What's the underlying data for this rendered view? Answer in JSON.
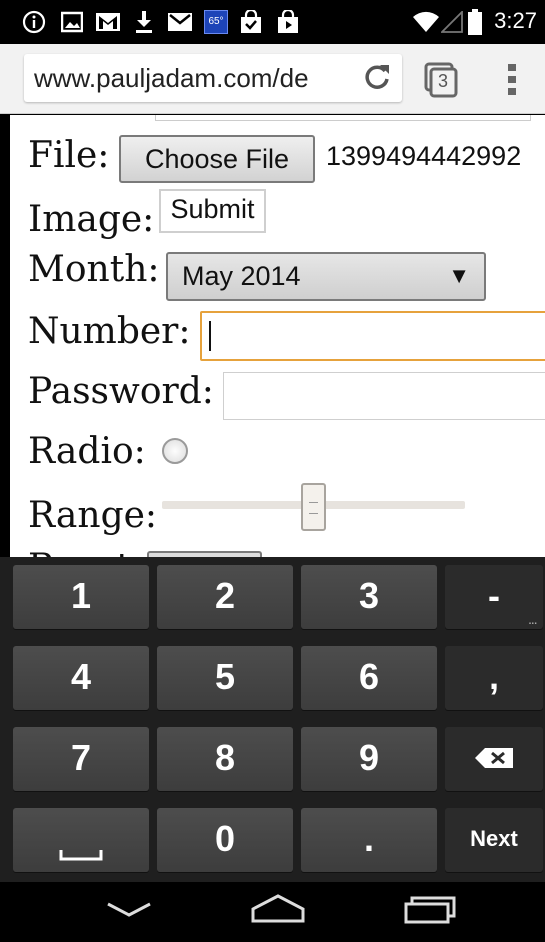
{
  "status_bar": {
    "time": "3:27",
    "icons": [
      "info-icon",
      "image-icon",
      "gmail-icon",
      "download-icon",
      "mail-icon",
      "weather-icon",
      "shopping-bag-icon",
      "play-store-icon",
      "wifi-icon",
      "signal-icon",
      "battery-icon"
    ],
    "weather_temp": "65°"
  },
  "browser": {
    "url": "www.pauljadam.com/de",
    "tab_count": "3"
  },
  "form": {
    "file_label": "File:",
    "choose_file_label": "Choose File",
    "file_name": "1399494442992",
    "image_label": "Image:",
    "submit_label": "Submit",
    "month_label": "Month:",
    "month_value": "May 2014",
    "number_label": "Number:",
    "password_label": "Password:",
    "radio_label": "Radio:",
    "range_label": "Range:",
    "range_level": 0.5,
    "partial_label": "Reset:"
  },
  "keyboard": {
    "keys": [
      [
        "1",
        "2",
        "3",
        "-"
      ],
      [
        "4",
        "5",
        "6",
        ","
      ],
      [
        "7",
        "8",
        "9",
        "backspace-icon"
      ],
      [
        "space-icon",
        "0",
        ".",
        "Next"
      ]
    ],
    "next_label": "Next"
  },
  "nav": {
    "icons": [
      "back-icon",
      "home-icon",
      "recents-icon"
    ]
  }
}
